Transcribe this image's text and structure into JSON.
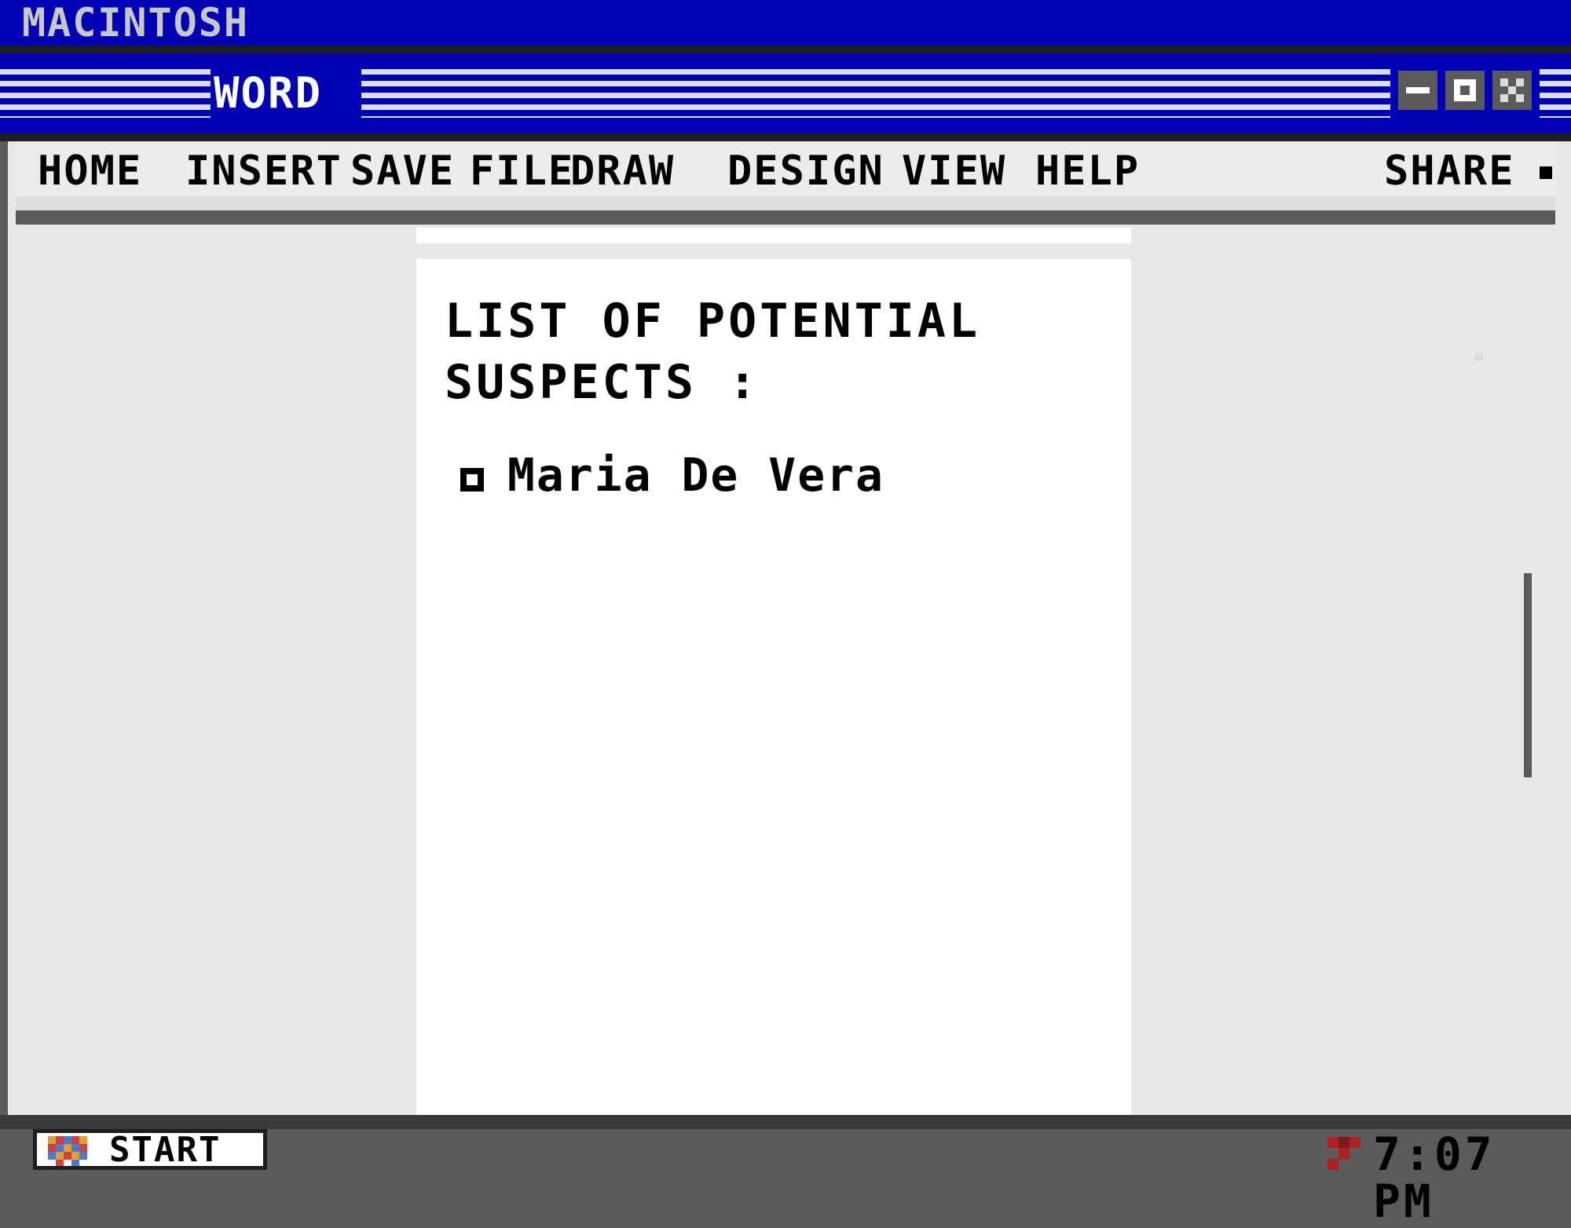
{
  "system_bar": {
    "title": "MACINTOSH"
  },
  "window": {
    "title": "WORD",
    "controls": {
      "minimize": "minimize-icon",
      "maximize": "maximize-icon",
      "close": "close-icon"
    }
  },
  "menu": {
    "items": [
      "HOME",
      "INSERT",
      "SAVE",
      "FILE",
      "DRAW",
      "DESIGN",
      "VIEW",
      "HELP"
    ],
    "share": "SHARE"
  },
  "document": {
    "heading": "LIST OF POTENTIAL SUSPECTS :",
    "items": [
      "Maria De Vera"
    ]
  },
  "taskbar": {
    "start_label": "START",
    "clock": "7:07 PM"
  },
  "colors": {
    "accent_blue": "#0000b4",
    "taskbar_gray": "#5a5a5a",
    "window_bg": "#e8e8e8"
  }
}
